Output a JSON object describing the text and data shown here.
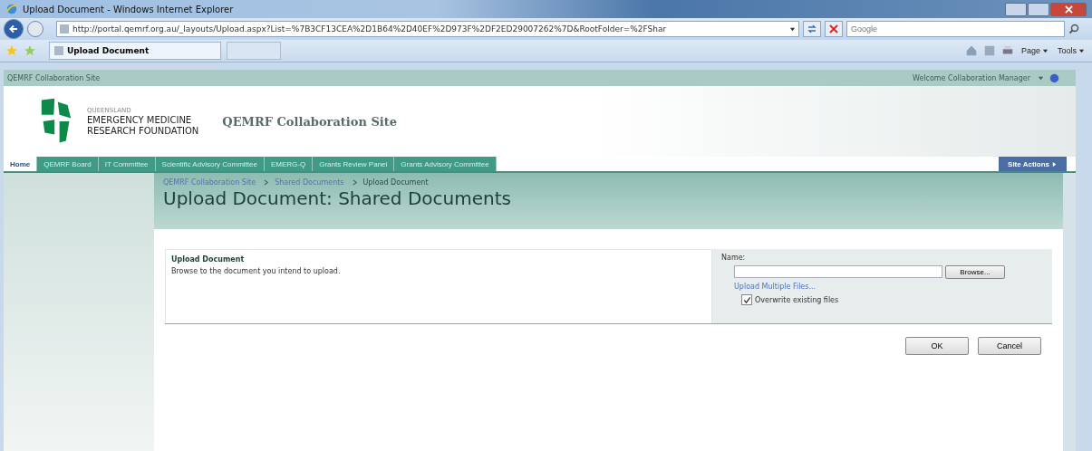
{
  "window": {
    "title": "Upload Document - Windows Internet Explorer"
  },
  "address_bar": {
    "url": "http://portal.qemrf.org.au/_layouts/Upload.aspx?List=%7B3CF13CEA%2D1B64%2D40EF%2D973F%2DF2ED29007262%7D&RootFolder=%2FShar"
  },
  "search": {
    "placeholder": "Google"
  },
  "browser_tab": {
    "label": "Upload Document"
  },
  "command_bar": [
    {
      "label": "Page"
    },
    {
      "label": "Tools"
    }
  ],
  "site_bar": {
    "site": "QEMRF Collaboration Site",
    "welcome": "Welcome Collaboration Manager"
  },
  "logo": {
    "line_1": "QUEENSLAND",
    "line_2": "EMERGENCY MEDICINE",
    "line_3": "RESEARCH FOUNDATION"
  },
  "site_title": "QEMRF Collaboration Site",
  "nav_tabs": [
    {
      "label": "Home",
      "selected": true
    },
    {
      "label": "QEMRF Board",
      "selected": false
    },
    {
      "label": "IT Committee",
      "selected": false
    },
    {
      "label": "Scientific Advisory Committee",
      "selected": false
    },
    {
      "label": "EMERG-Q",
      "selected": false
    },
    {
      "label": "Grants Review Panel",
      "selected": false
    },
    {
      "label": "Grants Advisory Committee",
      "selected": false
    }
  ],
  "site_actions": "Site Actions",
  "breadcrumb": [
    {
      "label": "QEMRF Collaboration Site",
      "link": true
    },
    {
      "label": "Shared Documents",
      "link": true
    },
    {
      "label": "Upload Document",
      "link": false
    }
  ],
  "page_title": "Upload Document: Shared Documents",
  "section": {
    "title": "Upload Document",
    "description": "Browse to the document you intend to upload."
  },
  "form": {
    "name_label": "Name:",
    "browse": "Browse...",
    "multiple_link": "Upload Multiple Files...",
    "overwrite": {
      "label": "Overwrite existing files",
      "checked": true
    }
  },
  "buttons": [
    {
      "label": "OK"
    },
    {
      "label": "Cancel"
    }
  ]
}
